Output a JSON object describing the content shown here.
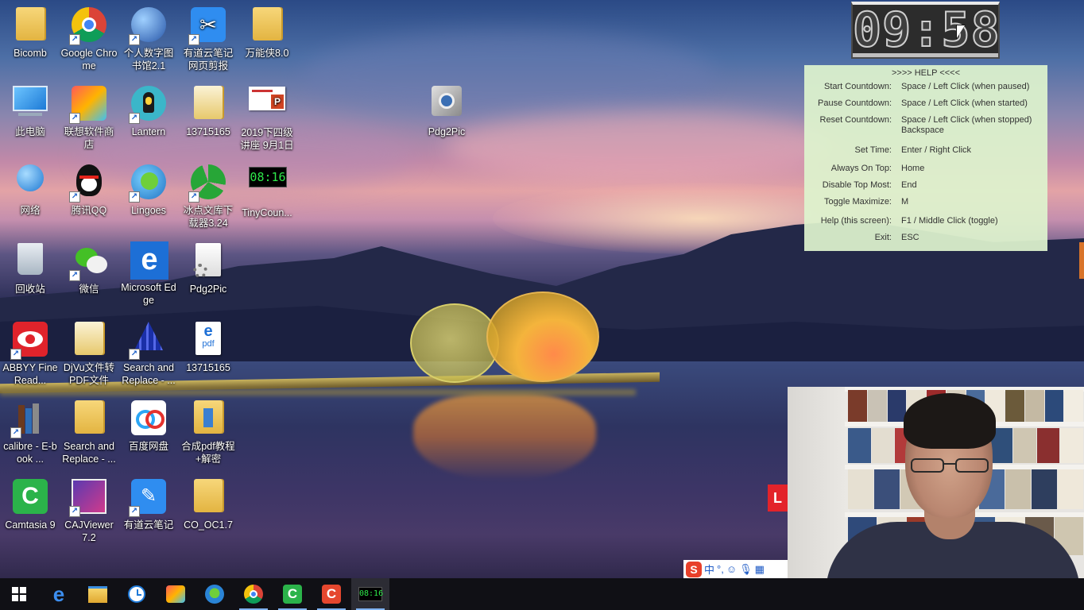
{
  "desktop": {
    "icons": [
      {
        "label": "Bicomb"
      },
      {
        "label": "Google Chrome"
      },
      {
        "label": "个人数字图书馆2.1"
      },
      {
        "label": "有道云笔记网页剪报"
      },
      {
        "label": "万能侠8.0"
      },
      {
        "label": "此电脑"
      },
      {
        "label": "联想软件商店"
      },
      {
        "label": "Lantern"
      },
      {
        "label": "13715165"
      },
      {
        "label": "2019下四级讲座 9月1日"
      },
      {
        "label": "Pdg2Pic"
      },
      {
        "label": "网络"
      },
      {
        "label": "腾讯QQ"
      },
      {
        "label": "Lingoes"
      },
      {
        "label": "冰点文库下载器3.24"
      },
      {
        "label": "TinyCoun..."
      },
      {
        "label": "回收站"
      },
      {
        "label": "微信"
      },
      {
        "label": "Microsoft Edge"
      },
      {
        "label": "Pdg2Pic"
      },
      {
        "label": "ABBYY FineRead..."
      },
      {
        "label": "DjVu文件转PDF文件"
      },
      {
        "label": "Search and Replace - ..."
      },
      {
        "label": "13715165"
      },
      {
        "label": "calibre - E-book ..."
      },
      {
        "label": "Search and Replace - ..."
      },
      {
        "label": "百度网盘"
      },
      {
        "label": "合成pdf教程+解密"
      },
      {
        "label": "Camtasia 9"
      },
      {
        "label": "CAJViewer 7.2"
      },
      {
        "label": "有道云笔记"
      },
      {
        "label": "CO_OC1.7"
      }
    ],
    "tinycounter_icon_text": "08:16",
    "pdf_icon_text": "pdf",
    "ppt_icon_text": "P"
  },
  "clock": {
    "time": "09:58"
  },
  "help": {
    "title": ">>>> HELP <<<<",
    "rows": [
      {
        "key": "Start Countdown:",
        "value": "Space / Left Click (when paused)"
      },
      {
        "key": "Pause Countdown:",
        "value": "Space / Left Click (when started)"
      },
      {
        "key": "Reset Countdown:",
        "value": "Space / Left Click (when stopped)",
        "value2": "Backspace"
      },
      {
        "key": "Set Time:",
        "value": "Enter / Right Click"
      },
      {
        "key": "Always On Top:",
        "value": "Home"
      },
      {
        "key": "Disable Top Most:",
        "value": "End"
      },
      {
        "key": "Toggle Maximize:",
        "value": "M"
      },
      {
        "key": "Help (this screen):",
        "value": "F1 / Middle Click (toggle)"
      },
      {
        "key": "Exit:",
        "value": "ESC"
      }
    ]
  },
  "ime": {
    "logo": "S",
    "mode": "中",
    "punct": "°,"
  },
  "partial_window_letter": "L",
  "taskbar": {
    "items": [
      {
        "icon": "windows-start-icon"
      },
      {
        "icon": "edge-icon"
      },
      {
        "icon": "file-explorer-icon"
      },
      {
        "icon": "clock-app-icon"
      },
      {
        "icon": "store-icon"
      },
      {
        "icon": "lingoes-icon"
      },
      {
        "icon": "chrome-icon"
      },
      {
        "icon": "camtasia-icon"
      },
      {
        "icon": "camtasia-recorder-icon"
      },
      {
        "icon": "tinycounter-icon"
      }
    ],
    "tinycounter_text": "08:16"
  },
  "colors": {
    "help_bg": "#def3ce",
    "taskbar_bg": "#101015",
    "chrome_red": "#db4437",
    "chrome_yellow": "#f4c20d",
    "chrome_green": "#0f9d58",
    "chrome_blue": "#4285f4"
  }
}
